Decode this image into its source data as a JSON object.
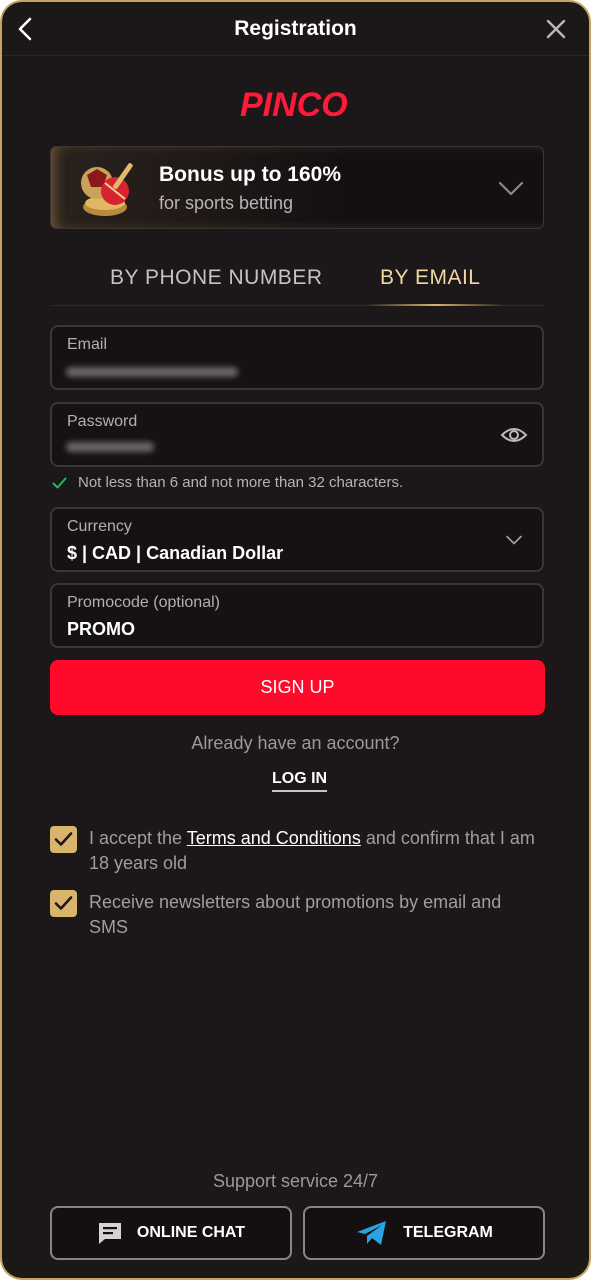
{
  "header": {
    "title": "Registration"
  },
  "logo": {
    "text": "PINCO"
  },
  "bonus": {
    "title": "Bonus up to 160%",
    "subtitle": "for sports betting"
  },
  "tabs": [
    {
      "label": "BY PHONE NUMBER",
      "active": false
    },
    {
      "label": "BY EMAIL",
      "active": true
    }
  ],
  "form": {
    "email": {
      "label": "Email"
    },
    "password": {
      "label": "Password"
    },
    "password_hint": "Not less than 6 and not more than 32 characters.",
    "currency": {
      "label": "Currency",
      "value": "$ | CAD | Canadian Dollar"
    },
    "promocode": {
      "label": "Promocode (optional)",
      "value": "PROMO"
    }
  },
  "actions": {
    "signup_label": "SIGN UP",
    "already_text": "Already have an account?",
    "login_label": "LOG IN"
  },
  "consents": {
    "terms_prefix": "I accept the ",
    "terms_link": "Terms and Conditions",
    "terms_suffix": " and confirm that I am 18 years old",
    "newsletter": "Receive newsletters about promotions by email and SMS"
  },
  "footer": {
    "support": "Support service 24/7",
    "chat_label": "ONLINE CHAT",
    "telegram_label": "TELEGRAM"
  },
  "colors": {
    "accent": "#ff0a2b",
    "gold": "#d9b46b",
    "background": "#1c1718"
  }
}
